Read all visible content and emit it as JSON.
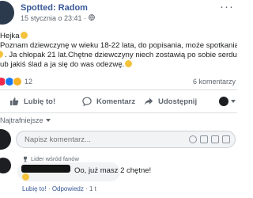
{
  "post": {
    "page_name": "Spotted: Radom",
    "timestamp": "15 stycznia o 23:41 ·",
    "more_icon": "ellipsis-icon",
    "body_lines": [
      "Hejka",
      "Poznam dziewczynę w wieku 18-22 lata, do popisania, może spotkania się",
      ". Ja chłopak 21 lat.Chętne dziewczyny niech zostawią po sobie serducho",
      "ub jakiś ślad a ja się do was odezwę."
    ]
  },
  "reactions": {
    "count": "12",
    "comments": "6 komentarzy",
    "colors": {
      "love": "#f0284a",
      "like": "#1877f2",
      "haha": "#f7b125"
    }
  },
  "actions": {
    "like": "Lubię to!",
    "comment": "Komentarz",
    "share": "Udostępnij"
  },
  "sort": {
    "label": "Najtrafniejsze"
  },
  "composer": {
    "placeholder": "Napisz komentarz..."
  },
  "reply": {
    "badge": "Lider wśród fanów",
    "text": "Oo, już masz 2 chętne!",
    "like": "Lubię to!",
    "separator1": " · ",
    "respond": "Odpowiedz",
    "separator2": " · ",
    "time": "1 t"
  },
  "colors": {
    "link": "#385898",
    "muted": "#606770",
    "bubble": "#f2f3f5"
  }
}
